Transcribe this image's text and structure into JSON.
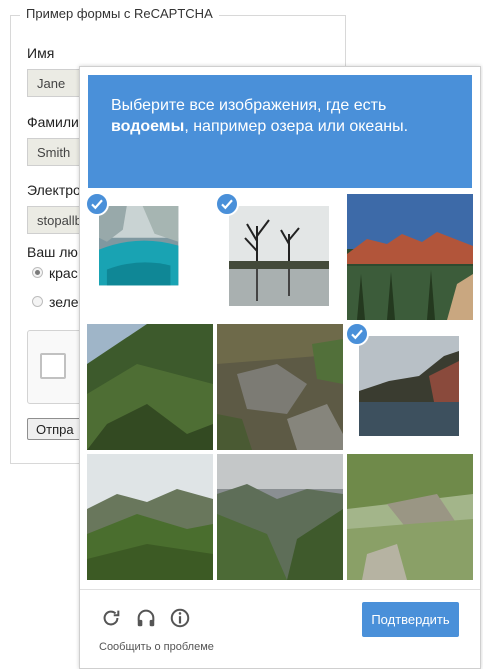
{
  "form": {
    "legend": "Пример формы с ReCAPTCHA",
    "first_name_label": "Имя",
    "first_name_value": "Jane",
    "last_name_label": "Фамили",
    "last_name_value": "Smith",
    "email_label": "Электро",
    "email_value": "stopallb",
    "fav_color_label": "Ваш лю",
    "radio_1_label": "крас",
    "radio_2_label": "зеле",
    "submit_label": "Отпра"
  },
  "challenge": {
    "instruction_pre": "Выберите все изображения, где есть ",
    "instruction_bold": "водоемы",
    "instruction_post": ", например озера или океаны.",
    "tiles": [
      {
        "name": "sea-cave",
        "selected": true
      },
      {
        "name": "pond-with-trees",
        "selected": true
      },
      {
        "name": "red-cliffs-forest",
        "selected": false
      },
      {
        "name": "forested-mountain",
        "selected": false
      },
      {
        "name": "rocky-ground",
        "selected": false
      },
      {
        "name": "mountain-lake",
        "selected": true
      },
      {
        "name": "green-hills",
        "selected": false
      },
      {
        "name": "valley-clouds",
        "selected": false
      },
      {
        "name": "rocky-slope",
        "selected": false
      }
    ],
    "reload_icon": "reload-icon",
    "audio_icon": "headphones-icon",
    "info_icon": "info-icon",
    "report_label": "Сообщить о проблеме",
    "verify_label": "Подтвердить",
    "accent_color": "#4a90d9"
  }
}
